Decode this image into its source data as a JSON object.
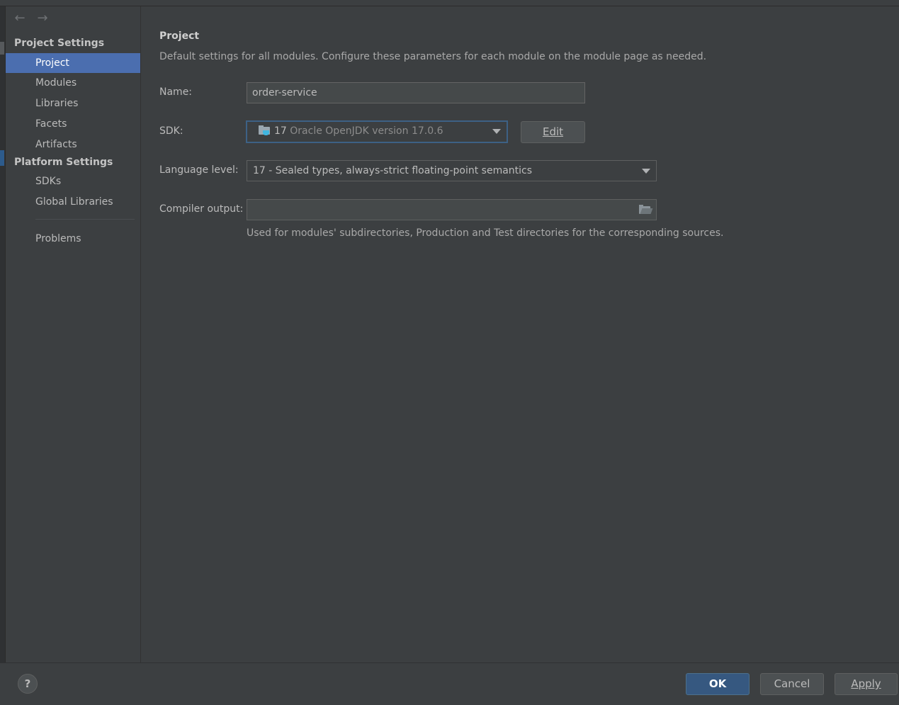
{
  "sidebar": {
    "section_project": "Project Settings",
    "project_items": [
      "Project",
      "Modules",
      "Libraries",
      "Facets",
      "Artifacts"
    ],
    "section_platform": "Platform Settings",
    "platform_items": [
      "SDKs",
      "Global Libraries"
    ],
    "problems": "Problems",
    "selected": "Project"
  },
  "content": {
    "title": "Project",
    "description": "Default settings for all modules. Configure these parameters for each module on the module page as needed.",
    "name_label": "Name:",
    "name_value": "order-service",
    "sdk_label": "SDK:",
    "sdk_version": "17",
    "sdk_name": "Oracle OpenJDK version 17.0.6",
    "edit_button": "Edit",
    "language_level_label": "Language level:",
    "language_level_value": "17 - Sealed types, always-strict floating-point semantics",
    "compiler_output_label": "Compiler output:",
    "compiler_output_value": "",
    "compiler_output_hint": "Used for modules' subdirectories, Production and Test directories for the corresponding sources."
  },
  "footer": {
    "help": "?",
    "ok": "OK",
    "cancel": "Cancel",
    "apply": "Apply"
  },
  "colors": {
    "background": "#3c3f41",
    "selection": "#4b6eaf",
    "default_button": "#365880",
    "focus_border": "#3d6185"
  }
}
